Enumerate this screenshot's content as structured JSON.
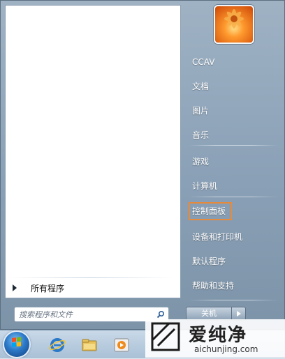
{
  "left_pane": {
    "all_programs_label": "所有程序",
    "search_placeholder": "搜索程序和文件"
  },
  "right_pane": {
    "items": [
      {
        "label": "CCAV"
      },
      {
        "label": "文档"
      },
      {
        "label": "图片"
      },
      {
        "label": "音乐"
      },
      {
        "label": "游戏"
      },
      {
        "label": "计算机"
      },
      {
        "label": "控制面板",
        "highlighted": true
      },
      {
        "label": "设备和打印机"
      },
      {
        "label": "默认程序"
      },
      {
        "label": "帮助和支持"
      }
    ],
    "shutdown_label": "关机"
  },
  "watermark": {
    "title": "爱纯净",
    "url": "aichunjing.com"
  },
  "colors": {
    "highlight_border": "#e68a3b",
    "menu_bg": "#8aa0b6"
  }
}
